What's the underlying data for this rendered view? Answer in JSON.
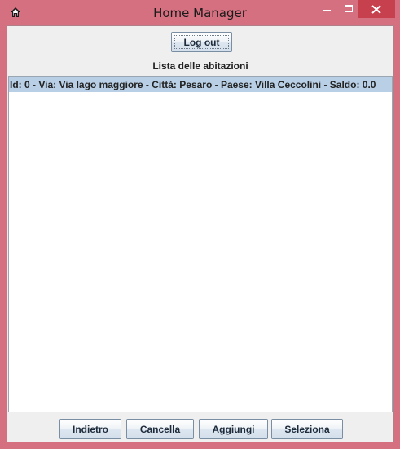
{
  "window": {
    "title": "Home Manager",
    "home_icon": "home-icon",
    "minimize_icon": "minimize-icon",
    "maximize_icon": "maximize-icon",
    "close_icon": "close-icon",
    "close_color": "#c7404d",
    "frame_color": "#d4707f"
  },
  "header": {
    "logout_label": "Log out",
    "list_title": "Lista delle abitazioni"
  },
  "list": {
    "items": [
      {
        "text": "Id: 0 - Via: Via lago maggiore - Città: Pesaro - Paese: Villa Ceccolini - Saldo: 0.0",
        "selected": true
      }
    ],
    "selection_color": "#b8cfe5"
  },
  "footer": {
    "back_label": "Indietro",
    "delete_label": "Cancella",
    "add_label": "Aggiungi",
    "select_label": "Seleziona"
  }
}
